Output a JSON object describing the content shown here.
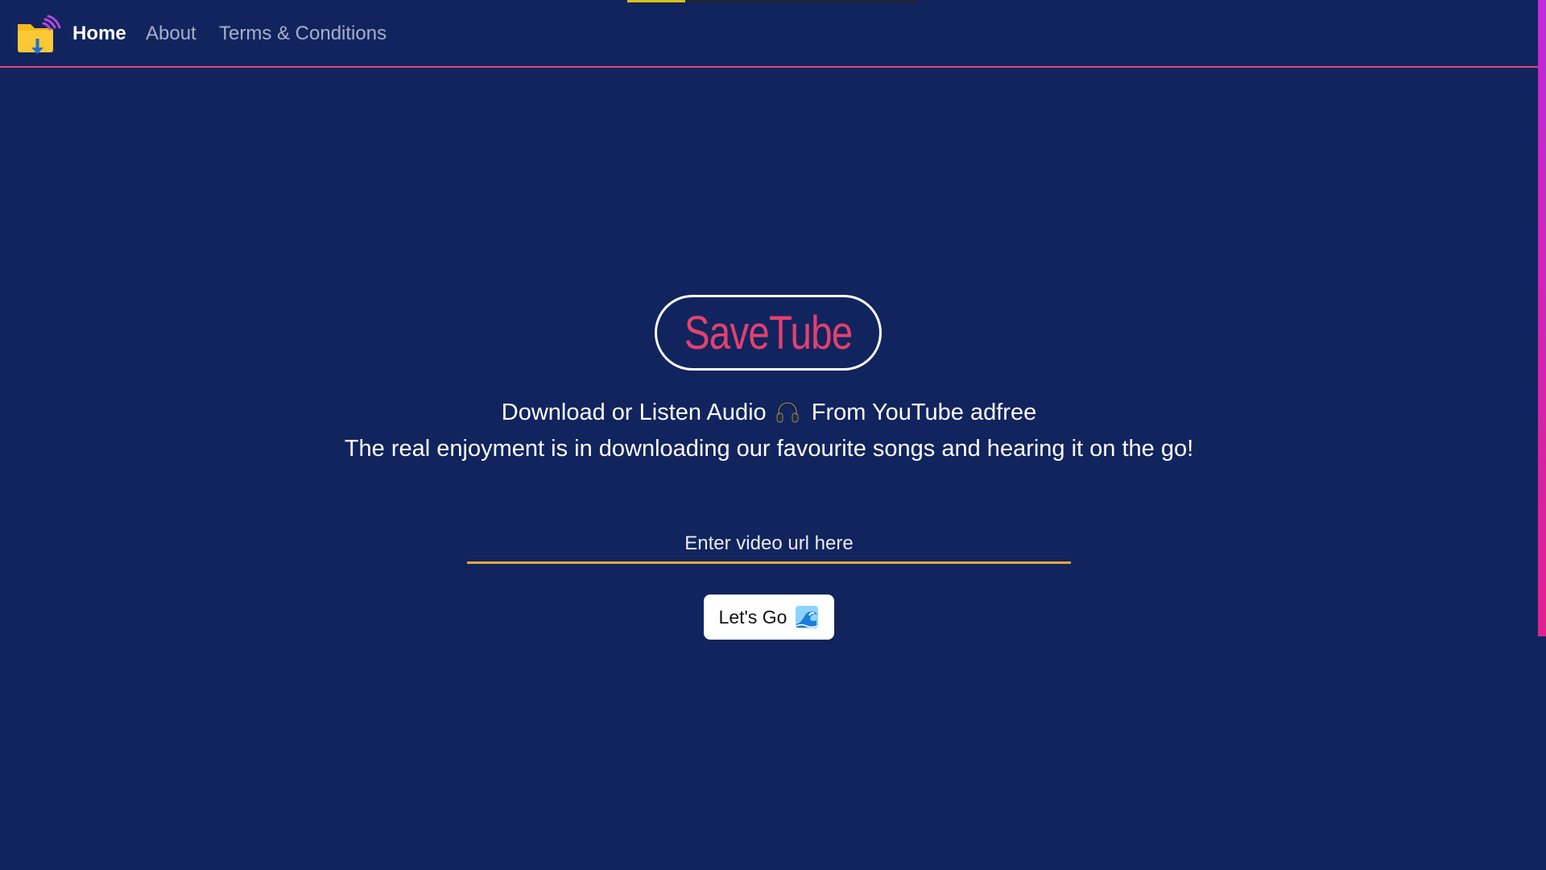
{
  "nav": {
    "logo_icon": "folder-download-icon",
    "home_label": "Home",
    "about_label": "About",
    "terms_label": "Terms & Conditions"
  },
  "top_progress": {
    "value_fraction": 0.2
  },
  "hero": {
    "brand_title": "SaveTube",
    "tagline_line1_before": "Download or Listen Audio",
    "tagline_icon": "headphone-icon",
    "tagline_line1_after": "From YouTube adfree",
    "tagline_line2": "The real enjoyment is in downloading our favourite songs and hearing it on the go!"
  },
  "form": {
    "url_placeholder": "Enter video url here",
    "url_value": "",
    "submit_label": "Let's Go",
    "submit_icon": "wave-icon"
  },
  "colors": {
    "background": "#12245e",
    "brand": "#e2416f",
    "nav_underline": "#e8407a",
    "input_underline": "#e8a83a",
    "scrollbar": "#c02ad8"
  }
}
